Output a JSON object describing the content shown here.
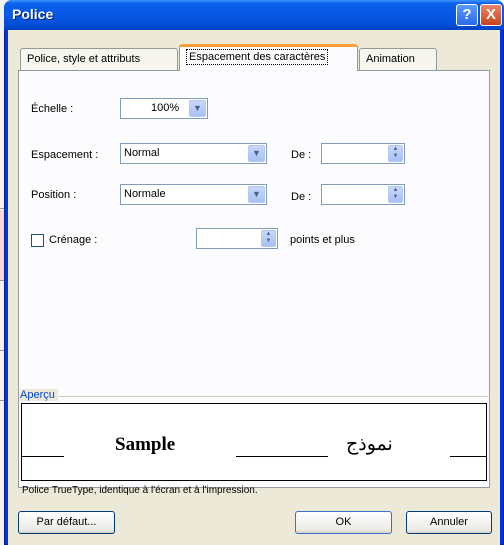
{
  "window": {
    "title": "Police",
    "help_glyph": "?",
    "close_glyph": "X"
  },
  "tabs": [
    {
      "label": "Police, style et attributs"
    },
    {
      "label": "Espacement des caractères",
      "active": true
    },
    {
      "label": "Animation"
    }
  ],
  "fields": {
    "echelle_label": "Échelle :",
    "echelle_value": "100%",
    "espacement_label": "Espacement :",
    "espacement_value": "Normal",
    "espacement_de_label": "De :",
    "espacement_de_value": "",
    "position_label": "Position :",
    "position_value": "Normale",
    "position_de_label": "De :",
    "position_de_value": "",
    "crenage_label": "Crénage :",
    "crenage_checked": false,
    "crenage_value": "",
    "crenage_suffix": "points et plus"
  },
  "preview": {
    "group_label": "Aperçu",
    "sample_text": "Sample",
    "arabic_text": "نموذج",
    "note": "Police TrueType, identique à l'écran et à l'impression."
  },
  "buttons": {
    "default": "Par défaut...",
    "ok": "OK",
    "cancel": "Annuler"
  },
  "icons": {
    "dropdown": "chevron-down-icon",
    "spin": "spin-arrows-icon",
    "help": "help-icon",
    "close": "close-icon"
  },
  "colors": {
    "titlebar": "#0758e4",
    "dialog_bg": "#ece9d8",
    "group_label": "#0046d5",
    "tab_highlight": "#f7a03a"
  }
}
